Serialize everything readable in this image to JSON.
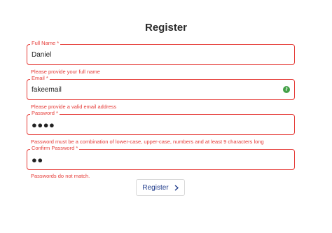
{
  "form": {
    "title": "Register",
    "full_name": {
      "label": "Full Name *",
      "value": "Daniel",
      "error": "Please provide your full name"
    },
    "email": {
      "label": "Email *",
      "value": "fakeemail",
      "error": "Please provide a valid email address",
      "extension_icon": "password-manager-icon"
    },
    "password": {
      "label": "Password *",
      "value": "●●●●",
      "error": "Password must be a combination of lower-case, upper-case, numbers and at least 9 characters long"
    },
    "confirm_password": {
      "label": "Confirm Password *",
      "value": "●●",
      "error": "Passwords do not match."
    },
    "submit": {
      "label": "Register",
      "icon": "chevron-right-icon"
    }
  },
  "colors": {
    "error": "#e53935",
    "button_text": "#1e3a8a",
    "extension_icon": "#43a047"
  }
}
